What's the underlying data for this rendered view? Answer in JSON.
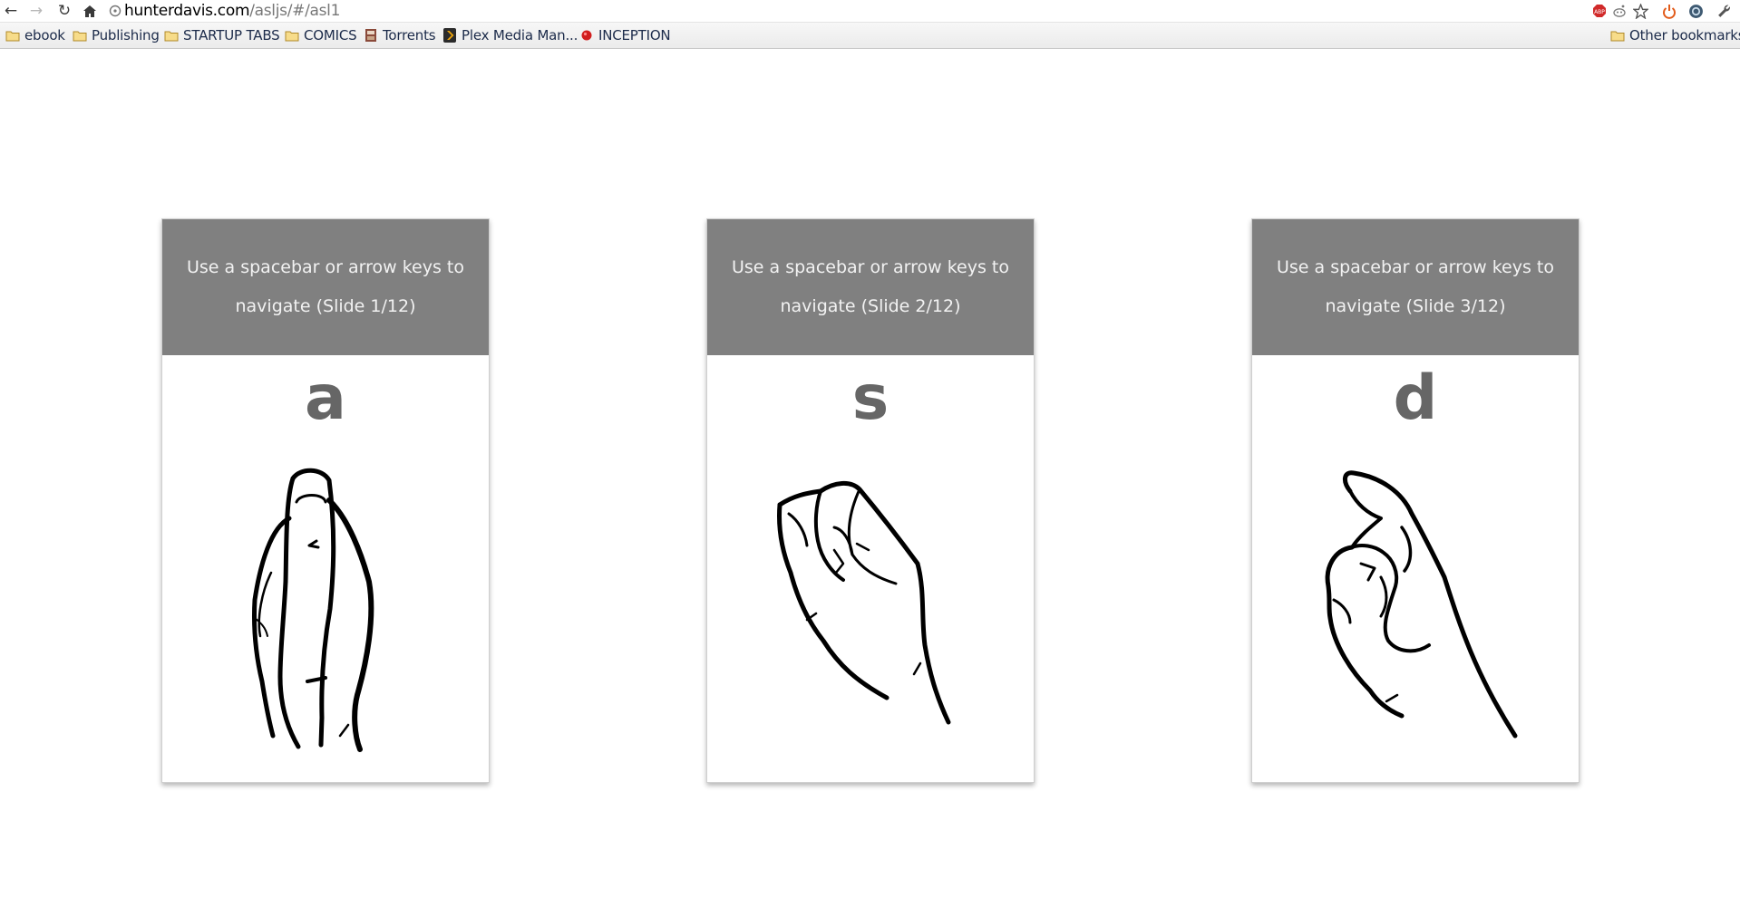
{
  "browser": {
    "url_host": "hunterdavis.com",
    "url_path": "/asljs/#/asl1",
    "nav_icons": [
      "back-icon",
      "forward-icon",
      "reload-icon",
      "home-icon"
    ],
    "extension_icons": [
      "adblock-icon",
      "reddit-icon",
      "bookmark-star-icon",
      "power-icon",
      "extension-icon",
      "wrench-icon"
    ],
    "bookmarks": [
      {
        "label": "ebook",
        "icon": "folder-icon"
      },
      {
        "label": "Publishing",
        "icon": "folder-icon"
      },
      {
        "label": "STARTUP TABS",
        "icon": "folder-icon"
      },
      {
        "label": "COMICS",
        "icon": "folder-icon"
      },
      {
        "label": "Torrents",
        "icon": "torrent-icon"
      },
      {
        "label": "Plex Media Man...",
        "icon": "plex-icon"
      },
      {
        "label": "INCEPTION",
        "icon": "red-dot-icon"
      }
    ],
    "other_bookmarks": "Other bookmarks"
  },
  "slides": [
    {
      "header": "Use a spacebar or arrow keys to navigate (Slide 1/12)",
      "letter": "a",
      "hand": "asl-letter-a-hand"
    },
    {
      "header": "Use a spacebar or arrow keys to navigate (Slide 2/12)",
      "letter": "s",
      "hand": "asl-letter-s-hand"
    },
    {
      "header": "Use a spacebar or arrow keys to navigate (Slide 3/12)",
      "letter": "d",
      "hand": "asl-letter-d-hand"
    }
  ],
  "colors": {
    "card_header": "#808080",
    "letter": "#666666",
    "link": "#1c2b4a"
  }
}
